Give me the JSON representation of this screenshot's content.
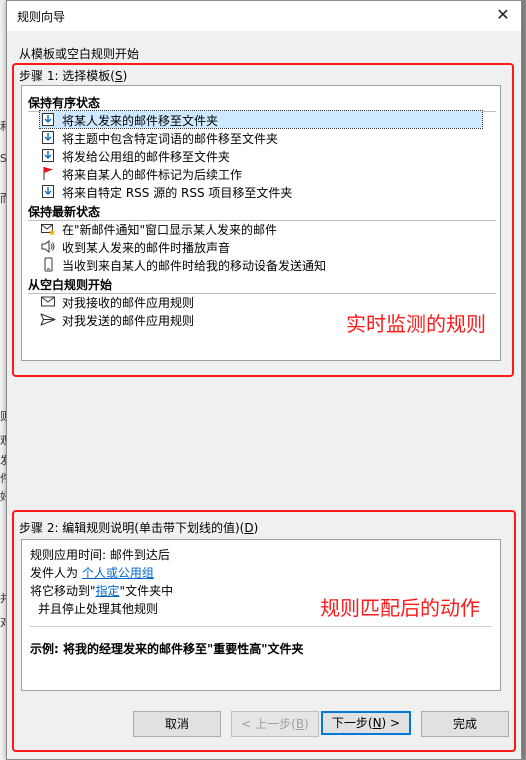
{
  "window": {
    "title": "规则向导",
    "close_glyph": "✕"
  },
  "background_fragments": [
    "和",
    "S",
    "而",
    "则",
    "观",
    "发",
    "件",
    "好",
    "并",
    "对"
  ],
  "header": {
    "subtitle": "从模板或空白规则开始"
  },
  "step1": {
    "label": "步骤 1: 选择模板(",
    "accel": "S",
    "label_end": ")",
    "groups": [
      {
        "title": "保持有序状态",
        "items": [
          {
            "label": "将某人发来的邮件移至文件夹",
            "icon": "move-to-folder-icon"
          },
          {
            "label": "将主题中包含特定词语的邮件移至文件夹",
            "icon": "move-to-folder-icon"
          },
          {
            "label": "将发给公用组的邮件移至文件夹",
            "icon": "move-to-folder-icon"
          },
          {
            "label": "将来自某人的邮件标记为后续工作",
            "icon": "red-flag-icon"
          },
          {
            "label": "将来自特定 RSS 源的 RSS 项目移至文件夹",
            "icon": "move-to-folder-icon"
          }
        ]
      },
      {
        "title": "保持最新状态",
        "items": [
          {
            "label": "在\"新邮件通知\"窗口显示某人发来的邮件",
            "icon": "new-mail-alert-icon"
          },
          {
            "label": "收到某人发来的邮件时播放声音",
            "icon": "speaker-icon"
          },
          {
            "label": "当收到来自某人的邮件时给我的移动设备发送通知",
            "icon": "mobile-device-icon"
          }
        ]
      },
      {
        "title": "从空白规则开始",
        "items": [
          {
            "label": "对我接收的邮件应用规则",
            "icon": "envelope-icon"
          },
          {
            "label": "对我发送的邮件应用规则",
            "icon": "send-icon"
          }
        ]
      }
    ]
  },
  "step2": {
    "label": "步骤 2: 编辑规则说明(单击带下划线的值)(",
    "accel": "D",
    "label_end": ")",
    "line1": "规则应用时间: 邮件到达后",
    "line2_prefix": "发件人为 ",
    "line2_link": "个人或公用组",
    "line3_prefix": "将它移动到\"",
    "line3_link": "指定",
    "line3_suffix": "\"文件夹中",
    "line4": "并且停止处理其他规则",
    "example": "示例: 将我的经理发来的邮件移至\"重要性高\"文件夹"
  },
  "buttons": {
    "cancel": "取消",
    "back_pre": "< 上一步(",
    "back_accel": "B",
    "back_post": ")",
    "next_pre": "下一步(",
    "next_accel": "N",
    "next_post": ") >",
    "finish": "完成"
  },
  "annotations": {
    "realtime": "实时监测的规则",
    "action": "规则匹配后的动作",
    "color": "#ff1a1a"
  }
}
